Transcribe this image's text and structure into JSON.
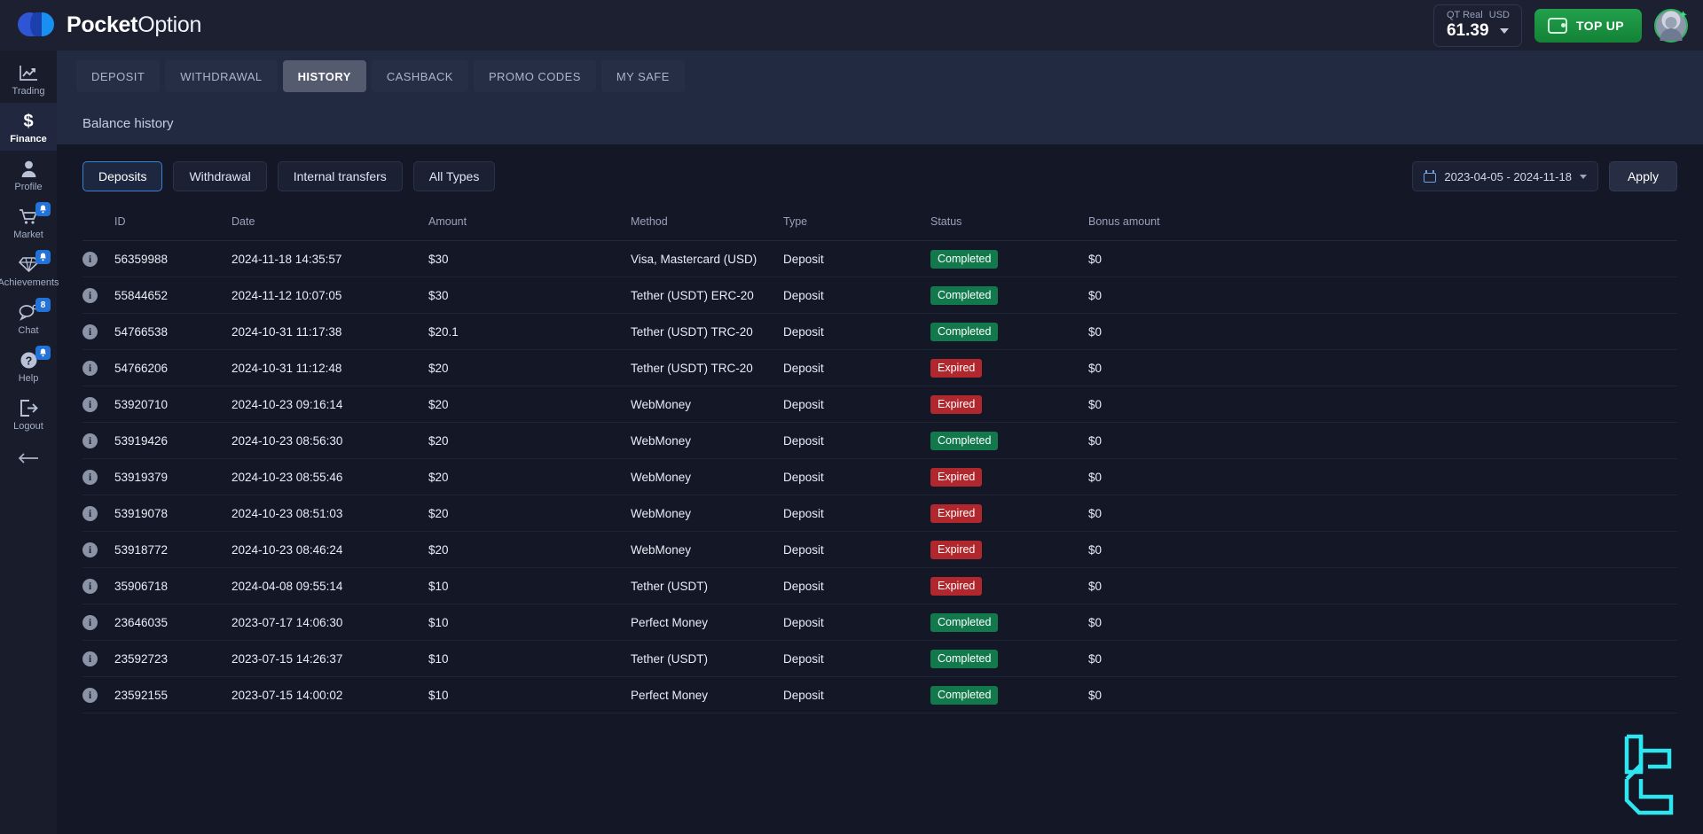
{
  "brand": {
    "name_bold": "Pocket",
    "name_light": "Option",
    "logo_icon": "pocketoption-logo-icon"
  },
  "header": {
    "account_type": "QT Real",
    "currency": "USD",
    "balance": "61.39",
    "topup_label": "TOP UP",
    "wallet_icon": "wallet-icon",
    "avatar_icon": "user-avatar-icon",
    "accent_green": "#1a9a4b"
  },
  "sidebar": {
    "items": [
      {
        "label": "Trading",
        "icon": "chart-line-icon",
        "active": false,
        "badge": ""
      },
      {
        "label": "Finance",
        "icon": "dollar-icon",
        "active": true,
        "badge": ""
      },
      {
        "label": "Profile",
        "icon": "user-icon",
        "active": false,
        "badge": ""
      },
      {
        "label": "Market",
        "icon": "cart-icon",
        "active": false,
        "badge": "bell"
      },
      {
        "label": "Achievements",
        "icon": "diamond-icon",
        "active": false,
        "badge": "bell"
      },
      {
        "label": "Chat",
        "icon": "chat-bubble-icon",
        "active": false,
        "badge": "8"
      },
      {
        "label": "Help",
        "icon": "question-circle-icon",
        "active": false,
        "badge": "bell"
      },
      {
        "label": "Logout",
        "icon": "logout-icon",
        "active": false,
        "badge": ""
      }
    ],
    "collapse_icon": "arrow-left-icon"
  },
  "tabs": [
    {
      "label": "DEPOSIT",
      "active": false
    },
    {
      "label": "WITHDRAWAL",
      "active": false
    },
    {
      "label": "HISTORY",
      "active": true
    },
    {
      "label": "CASHBACK",
      "active": false
    },
    {
      "label": "PROMO CODES",
      "active": false
    },
    {
      "label": "MY SAFE",
      "active": false
    }
  ],
  "section": {
    "title": "Balance history"
  },
  "filters": {
    "buttons": [
      {
        "label": "Deposits",
        "active": true
      },
      {
        "label": "Withdrawal",
        "active": false
      },
      {
        "label": "Internal transfers",
        "active": false
      },
      {
        "label": "All Types",
        "active": false
      }
    ],
    "date_range": "2023-04-05 - 2024-11-18",
    "calendar_icon": "calendar-icon",
    "dropdown_icon": "chevron-down-icon",
    "apply_label": "Apply"
  },
  "table": {
    "columns": [
      "ID",
      "Date",
      "Amount",
      "Method",
      "Type",
      "Status",
      "Bonus amount"
    ],
    "info_icon": "info-icon",
    "rows": [
      {
        "id": "56359988",
        "date": "2024-11-18 14:35:57",
        "amount": "$30",
        "method": "Visa, Mastercard (USD)",
        "type": "Deposit",
        "status": "Completed",
        "bonus": "$0"
      },
      {
        "id": "55844652",
        "date": "2024-11-12 10:07:05",
        "amount": "$30",
        "method": "Tether (USDT) ERC-20",
        "type": "Deposit",
        "status": "Completed",
        "bonus": "$0"
      },
      {
        "id": "54766538",
        "date": "2024-10-31 11:17:38",
        "amount": "$20.1",
        "method": "Tether (USDT) TRC-20",
        "type": "Deposit",
        "status": "Completed",
        "bonus": "$0"
      },
      {
        "id": "54766206",
        "date": "2024-10-31 11:12:48",
        "amount": "$20",
        "method": "Tether (USDT) TRC-20",
        "type": "Deposit",
        "status": "Expired",
        "bonus": "$0"
      },
      {
        "id": "53920710",
        "date": "2024-10-23 09:16:14",
        "amount": "$20",
        "method": "WebMoney",
        "type": "Deposit",
        "status": "Expired",
        "bonus": "$0"
      },
      {
        "id": "53919426",
        "date": "2024-10-23 08:56:30",
        "amount": "$20",
        "method": "WebMoney",
        "type": "Deposit",
        "status": "Completed",
        "bonus": "$0"
      },
      {
        "id": "53919379",
        "date": "2024-10-23 08:55:46",
        "amount": "$20",
        "method": "WebMoney",
        "type": "Deposit",
        "status": "Expired",
        "bonus": "$0"
      },
      {
        "id": "53919078",
        "date": "2024-10-23 08:51:03",
        "amount": "$20",
        "method": "WebMoney",
        "type": "Deposit",
        "status": "Expired",
        "bonus": "$0"
      },
      {
        "id": "53918772",
        "date": "2024-10-23 08:46:24",
        "amount": "$20",
        "method": "WebMoney",
        "type": "Deposit",
        "status": "Expired",
        "bonus": "$0"
      },
      {
        "id": "35906718",
        "date": "2024-04-08 09:55:14",
        "amount": "$10",
        "method": "Tether (USDT)",
        "type": "Deposit",
        "status": "Expired",
        "bonus": "$0"
      },
      {
        "id": "23646035",
        "date": "2023-07-17 14:06:30",
        "amount": "$10",
        "method": "Perfect Money",
        "type": "Deposit",
        "status": "Completed",
        "bonus": "$0"
      },
      {
        "id": "23592723",
        "date": "2023-07-15 14:26:37",
        "amount": "$10",
        "method": "Tether (USDT)",
        "type": "Deposit",
        "status": "Completed",
        "bonus": "$0"
      },
      {
        "id": "23592155",
        "date": "2023-07-15 14:00:02",
        "amount": "$10",
        "method": "Perfect Money",
        "type": "Deposit",
        "status": "Completed",
        "bonus": "$0"
      }
    ]
  },
  "watermark": {
    "icon": "lc-watermark-icon",
    "color": "#2ee6f0"
  },
  "colors": {
    "status_completed": "#12794c",
    "status_expired": "#b0282e",
    "accent_blue": "#3d7fd6",
    "page_bg": "#131726"
  }
}
